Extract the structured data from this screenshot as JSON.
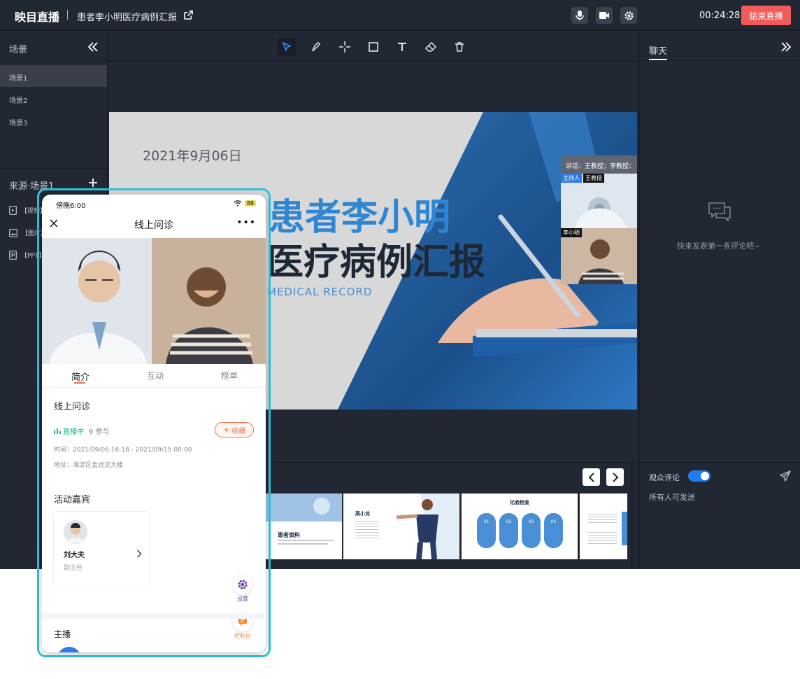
{
  "app": {
    "brand": "映目直播",
    "doc_title": "患者李小明医疗病例汇报",
    "timer": "00:24:28",
    "end_label": "结束直播"
  },
  "icons": {
    "mic": "mic-icon",
    "camera": "camera-icon",
    "settings": "gear-icon",
    "external": "external-link-icon"
  },
  "colors": {
    "accent": "#1f7cf3",
    "danger": "#f25b59",
    "cyan": "#30c1d6",
    "orange": "#f26e41",
    "green": "#13b878"
  },
  "scenes": {
    "title": "场景",
    "items": [
      "场景1",
      "场景2",
      "场景3"
    ],
    "active_index": 0
  },
  "sources": {
    "title": "来源·场景1",
    "items": [
      "【视频】",
      "【图片】",
      "【PPT】"
    ]
  },
  "slide": {
    "date": "2021年9月06日",
    "title1": "患者李小明",
    "title2": "医疗病例汇报",
    "subtitle": "MEDICAL RECORD"
  },
  "speakers": {
    "bar": "讲话：王教授；李教授：",
    "host_tag": "主持人",
    "host_name": "王教授",
    "guest_name": "李小明"
  },
  "thumbnails": {
    "t1_title": "患者资料",
    "t2_title": "高小龙",
    "t3_title": "化验检查",
    "t3_pills": [
      "01",
      "02",
      "03",
      "04"
    ]
  },
  "chat": {
    "tab": "聊天",
    "empty": "快来发表第一条评论吧~",
    "comment_label": "观众评论",
    "comment_sub": "所有人可发送",
    "comment_enabled": true
  },
  "phone": {
    "time": "傍晚6:00",
    "battery": "88",
    "title": "线上问诊",
    "tabs": [
      "简介",
      "互动",
      "榜单"
    ],
    "section_title": "线上问诊",
    "live_label": "直播中",
    "participants": "9 参与",
    "fav_label": "收藏",
    "time_info": "时间：2021/09/06 16:18 - 2021/09/15 00:00",
    "address": "地址：海淀区金远见大楼",
    "guests_title": "活动嘉宾",
    "guest_name": "刘大夫",
    "guest_role": "副主任",
    "settings_label": "设置",
    "console_label": "控制台",
    "host_title": "主播"
  }
}
